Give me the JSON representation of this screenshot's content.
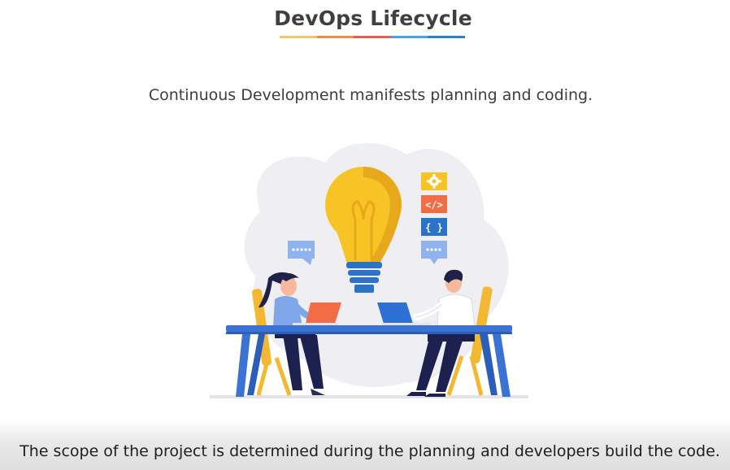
{
  "slide": {
    "title": "DevOps Lifecycle",
    "subtitle": "Continuous Development manifests planning and coding.",
    "caption": "The scope of the project is determined during the planning and developers build the code."
  },
  "title_underline_colors": [
    "#f2c46b",
    "#f08a4b",
    "#e55b4f",
    "#4aa3df",
    "#2f7fc4"
  ],
  "illustration": {
    "icons": {
      "gear_symbol": "gear-icon",
      "code_tag_symbol": "</>",
      "braces_symbol": "{ }",
      "chat_dots": "....",
      "speech_dots": "....."
    },
    "colors": {
      "bulb": "#f7c325",
      "bulb_shade": "#e8a81c",
      "bulb_base": "#2b72c9",
      "table": "#3b73d4",
      "blob": "#efeff3",
      "chair": "#f4b731",
      "laptop_orange": "#f26c45",
      "laptop_blue": "#2e6fd6",
      "skin": "#f7b89c",
      "hair": "#1e2248",
      "pants": "#1c2150"
    }
  }
}
